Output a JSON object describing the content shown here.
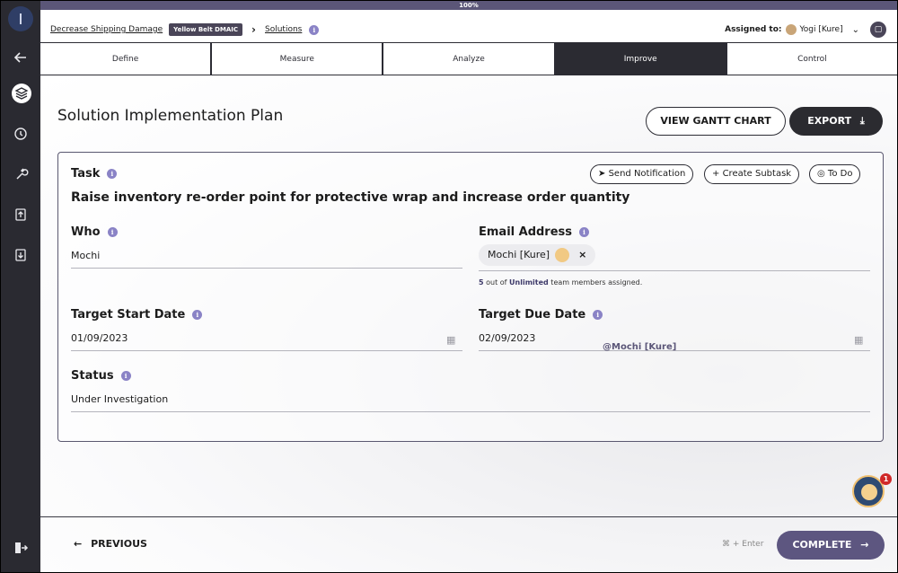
{
  "progress": {
    "label": "100%",
    "value": 1.0
  },
  "breadcrumb": {
    "project": "Decrease Shipping Damage",
    "badge": "Yellow Belt DMAIC",
    "current": "Solutions"
  },
  "assigned": {
    "label": "Assigned to:",
    "name": "Yogi [Kure]"
  },
  "tabs": [
    {
      "label": "Define"
    },
    {
      "label": "Measure"
    },
    {
      "label": "Analyze"
    },
    {
      "label": "Improve",
      "active": true
    },
    {
      "label": "Control"
    }
  ],
  "page": {
    "title": "Solution Implementation Plan",
    "gantt_button": "VIEW GANTT CHART",
    "export_button": "EXPORT"
  },
  "task": {
    "label": "Task",
    "text": "Raise inventory re-order point for protective wrap and increase order quantity",
    "send_notification": "Send Notification",
    "create_subtask": "Create Subtask",
    "status_button": "To Do"
  },
  "who": {
    "label": "Who",
    "value": "Mochi"
  },
  "email": {
    "label": "Email Address",
    "chip": "Mochi [Kure]",
    "members_count": "5",
    "members_mid": " out of ",
    "members_limit": "Unlimited",
    "members_tail": " team members assigned."
  },
  "start_date": {
    "label": "Target Start Date",
    "value": "01/09/2023"
  },
  "due_date": {
    "label": "Target Due Date",
    "value": "02/09/2023"
  },
  "mention": "@Mochi [Kure]",
  "status": {
    "label": "Status",
    "value": "Under Investigation"
  },
  "notifications": {
    "count": "1"
  },
  "footer": {
    "previous": "PREVIOUS",
    "shortcut": "⌘ + Enter",
    "complete": "COMPLETE"
  },
  "colors": {
    "sidebar": "#2a2a31",
    "accent": "#5d5680",
    "active_tab": "#2b2b32",
    "info": "#8a83c6"
  }
}
